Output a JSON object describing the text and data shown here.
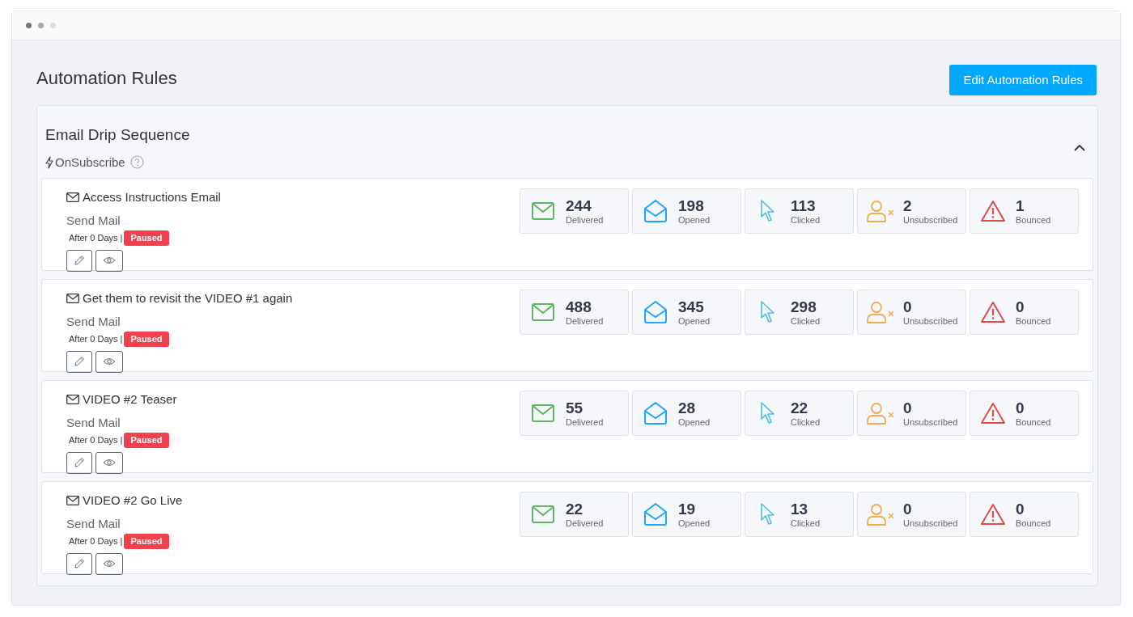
{
  "page": {
    "title": "Automation Rules",
    "edit_button": "Edit Automation Rules"
  },
  "sequence": {
    "title": "Email Drip Sequence",
    "trigger": "OnSubscribe",
    "expanded": true,
    "steps": [
      {
        "name": "Access Instructions Email",
        "action": "Send Mail",
        "delay": "After 0 Days |",
        "status": {
          "kind": "paused",
          "label": "Paused"
        },
        "stats": [
          {
            "kind": "delivered",
            "value": "244",
            "label": "Delivered"
          },
          {
            "kind": "opened",
            "value": "198",
            "label": "Opened"
          },
          {
            "kind": "clicked",
            "value": "113",
            "label": "Clicked"
          },
          {
            "kind": "unsubscribed",
            "value": "2",
            "label": "Unsubscribed"
          },
          {
            "kind": "bounced",
            "value": "1",
            "label": "Bounced"
          }
        ]
      },
      {
        "name": "Get them to revisit the VIDEO #1 again",
        "action": "Send Mail",
        "delay": "After 0 Days |",
        "status": {
          "kind": "paused",
          "label": "Paused"
        },
        "stats": [
          {
            "kind": "delivered",
            "value": "488",
            "label": "Delivered"
          },
          {
            "kind": "opened",
            "value": "345",
            "label": "Opened"
          },
          {
            "kind": "clicked",
            "value": "298",
            "label": "Clicked"
          },
          {
            "kind": "unsubscribed",
            "value": "0",
            "label": "Unsubscribed"
          },
          {
            "kind": "bounced",
            "value": "0",
            "label": "Bounced"
          }
        ]
      },
      {
        "name": "VIDEO #2 Teaser",
        "action": "Send Mail",
        "delay": "After 0 Days |",
        "status": {
          "kind": "paused",
          "label": "Paused"
        },
        "stats": [
          {
            "kind": "delivered",
            "value": "55",
            "label": "Delivered"
          },
          {
            "kind": "opened",
            "value": "28",
            "label": "Opened"
          },
          {
            "kind": "clicked",
            "value": "22",
            "label": "Clicked"
          },
          {
            "kind": "unsubscribed",
            "value": "0",
            "label": "Unsubscribed"
          },
          {
            "kind": "bounced",
            "value": "0",
            "label": "Bounced"
          }
        ]
      },
      {
        "name": "VIDEO #2 Go Live",
        "action": "Send Mail",
        "delay": "After 0 Days |",
        "status": {
          "kind": "paused",
          "label": "Paused"
        },
        "stats": [
          {
            "kind": "delivered",
            "value": "22",
            "label": "Delivered"
          },
          {
            "kind": "opened",
            "value": "19",
            "label": "Opened"
          },
          {
            "kind": "clicked",
            "value": "13",
            "label": "Clicked"
          },
          {
            "kind": "unsubscribed",
            "value": "0",
            "label": "Unsubscribed"
          },
          {
            "kind": "bounced",
            "value": "0",
            "label": "Bounced"
          }
        ]
      }
    ]
  }
}
